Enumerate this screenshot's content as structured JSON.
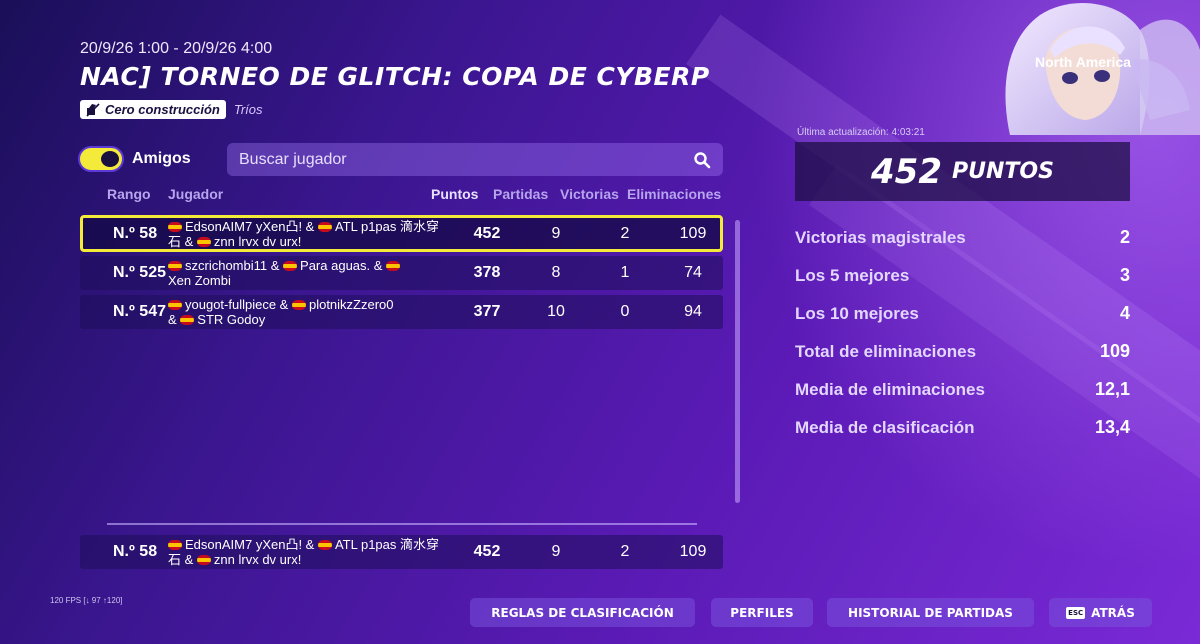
{
  "header": {
    "date_range": "20/9/26 1:00 - 20/9/26 4:00",
    "title": "NAC] TORNEO DE GLITCH: COPA DE CYBERP",
    "mode_badge": "Cero construcción",
    "mode_sub": "Tríos",
    "region": "North America"
  },
  "filters": {
    "friends_toggle_label": "Amigos",
    "friends_toggle_on": true,
    "search_placeholder": "Buscar jugador"
  },
  "table": {
    "columns": {
      "rank": "Rango",
      "player": "Jugador",
      "points": "Puntos",
      "matches": "Partidas",
      "wins": "Victorias",
      "eliminations": "Eliminaciones"
    },
    "rows": [
      {
        "rank": "N.º 58",
        "p1": "EdsonAIM7 yXen凸! &",
        "p2": "ATL p1pas 滴水穿",
        "p3": "石 &",
        "p4": "znn lrvx dv urx!",
        "points": "452",
        "matches": "9",
        "wins": "2",
        "eliminations": "109",
        "highlight": true
      },
      {
        "rank": "N.º 525",
        "p1": "szcrichombi11 &",
        "p2": "Para aguas. &",
        "p3": "",
        "p4": "Xen Zombi",
        "points": "378",
        "matches": "8",
        "wins": "1",
        "eliminations": "74",
        "highlight": false
      },
      {
        "rank": "N.º 547",
        "p1": "yougot-fullpiece &",
        "p2": "plotnikzZzero0",
        "p3": "&",
        "p4": "STR Godoy",
        "points": "377",
        "matches": "10",
        "wins": "0",
        "eliminations": "94",
        "highlight": false
      }
    ],
    "self_row": {
      "rank": "N.º 58",
      "p1": "EdsonAIM7 yXen凸! &",
      "p2": "ATL p1pas 滴水穿",
      "p3": "石 &",
      "p4": "znn lrvx dv urx!",
      "points": "452",
      "matches": "9",
      "wins": "2",
      "eliminations": "109"
    }
  },
  "summary": {
    "last_update": "Última actualización: 4:03:21",
    "points_value": "452",
    "points_unit": "PUNTOS",
    "stats": [
      {
        "label": "Victorias magistrales",
        "value": "2"
      },
      {
        "label": "Los 5 mejores",
        "value": "3"
      },
      {
        "label": "Los 10 mejores",
        "value": "4"
      },
      {
        "label": "Total de eliminaciones",
        "value": "109"
      },
      {
        "label": "Media de eliminaciones",
        "value": "12,1"
      },
      {
        "label": "Media de clasificación",
        "value": "13,4"
      }
    ]
  },
  "footer": {
    "fps": "120 FPS [↓ 97 ↑120]",
    "rules_button": "REGLAS DE CLASIFICACIÓN",
    "profiles_button": "PERFILES",
    "history_button": "HISTORIAL DE PARTIDAS",
    "esc_key": "ESC",
    "back_button": "ATRÁS"
  },
  "colors": {
    "accent_yellow": "#f4ea3a",
    "background_start": "#1a0f58",
    "background_end": "#7a2ad6",
    "spain_flag_red": "#c60b1e",
    "spain_flag_yellow": "#ffc400"
  },
  "icons": [
    "no-build-icon",
    "search-icon",
    "spain-flag-icon",
    "esc-key-icon"
  ]
}
